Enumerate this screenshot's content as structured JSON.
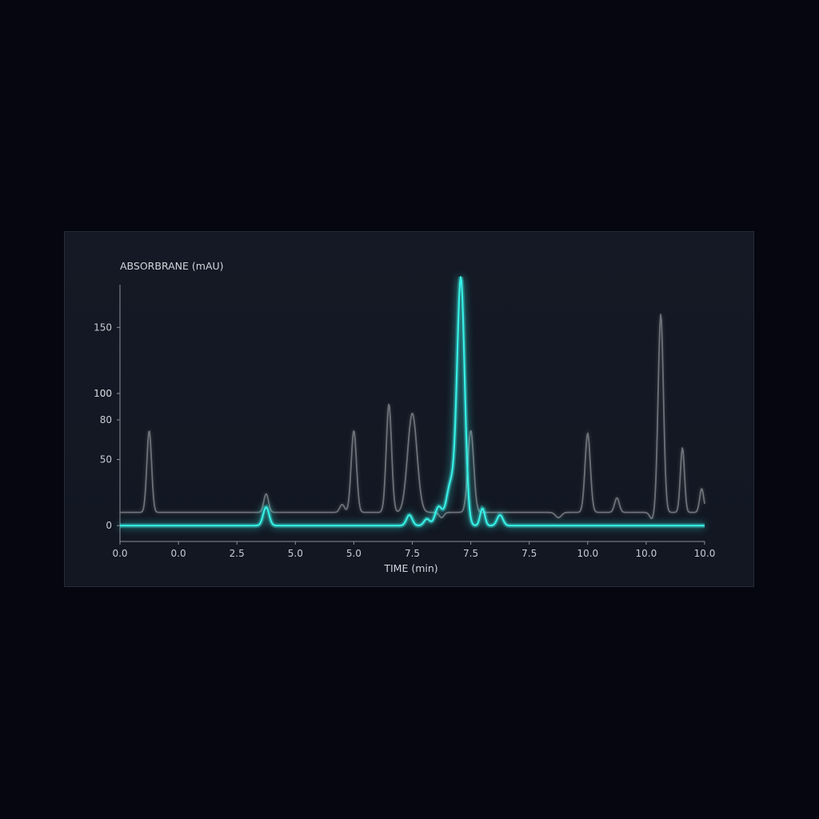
{
  "colors": {
    "background": "#05060f",
    "panel": "#141925",
    "axis": "#8a8f98",
    "text": "#c8ccd3",
    "highlight": "#37f0e6",
    "reference": "#6d7178"
  },
  "chart_data": {
    "type": "line",
    "ylabel": "ABSORBRANE (mAU)",
    "xlabel": "TIME (min)",
    "x_ticks": [
      "0.0",
      "0.0",
      "2.5",
      "5.0",
      "5.0",
      "7.5",
      "7.5",
      "7.5",
      "10.0",
      "10.0",
      "10.0"
    ],
    "y_ticks": [
      "0",
      "50",
      "80",
      "100",
      "100",
      "150"
    ],
    "grid": false,
    "series": [
      {
        "style": "highlight",
        "baseline": 0,
        "peaks": [
          {
            "x": 2.5,
            "y": 14,
            "w": 0.05
          },
          {
            "x": 4.95,
            "y": 8,
            "w": 0.05
          },
          {
            "x": 5.25,
            "y": 5,
            "w": 0.05
          },
          {
            "x": 5.45,
            "y": 14,
            "w": 0.06
          },
          {
            "x": 5.65,
            "y": 30,
            "w": 0.07
          },
          {
            "x": 5.83,
            "y": 187,
            "w": 0.065
          },
          {
            "x": 6.2,
            "y": 13,
            "w": 0.04
          },
          {
            "x": 6.5,
            "y": 8,
            "w": 0.05
          }
        ]
      },
      {
        "style": "reference",
        "baseline": 10,
        "peaks": [
          {
            "x": 0.5,
            "y": 72,
            "w": 0.04
          },
          {
            "x": 0.8,
            "y": 10,
            "w": 0.04
          },
          {
            "x": 2.5,
            "y": 24,
            "w": 0.04
          },
          {
            "x": 3.8,
            "y": 16,
            "w": 0.04
          },
          {
            "x": 4.0,
            "y": 72,
            "w": 0.045
          },
          {
            "x": 4.6,
            "y": 92,
            "w": 0.045
          },
          {
            "x": 5.0,
            "y": 85,
            "w": 0.08
          },
          {
            "x": 5.5,
            "y": 6,
            "w": 0.04
          },
          {
            "x": 6.0,
            "y": 72,
            "w": 0.05
          },
          {
            "x": 6.2,
            "y": 10,
            "w": 0.04
          },
          {
            "x": 6.5,
            "y": 10,
            "w": 0.04
          },
          {
            "x": 7.5,
            "y": 6,
            "w": 0.05
          },
          {
            "x": 8.0,
            "y": 70,
            "w": 0.045
          },
          {
            "x": 8.5,
            "y": 21,
            "w": 0.04
          },
          {
            "x": 9.1,
            "y": 5,
            "w": 0.04
          },
          {
            "x": 9.25,
            "y": 160,
            "w": 0.045
          },
          {
            "x": 9.62,
            "y": 59,
            "w": 0.035
          },
          {
            "x": 9.95,
            "y": 28,
            "w": 0.035
          }
        ]
      }
    ],
    "xlim": [
      0,
      10
    ],
    "ylim": [
      -12,
      198
    ]
  }
}
